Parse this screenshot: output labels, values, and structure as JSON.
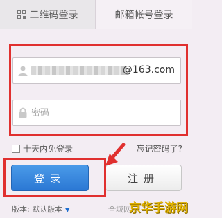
{
  "tabs": {
    "qr_login": "二维码登录",
    "mail_login": "邮箱帐号登录"
  },
  "username": {
    "domain_suffix": "@163.com"
  },
  "password": {
    "placeholder": "密码"
  },
  "options": {
    "remember_label": "十天内免登录",
    "forgot_label": "忘记密码了?"
  },
  "buttons": {
    "login": "登录",
    "register": "注册"
  },
  "footer": {
    "version_label": "版本: 默认版本",
    "fragment": "全域网",
    "watermark": "京华手游网"
  },
  "colors": {
    "annotation_red": "#e0302f",
    "login_blue": "#2b78d4"
  }
}
